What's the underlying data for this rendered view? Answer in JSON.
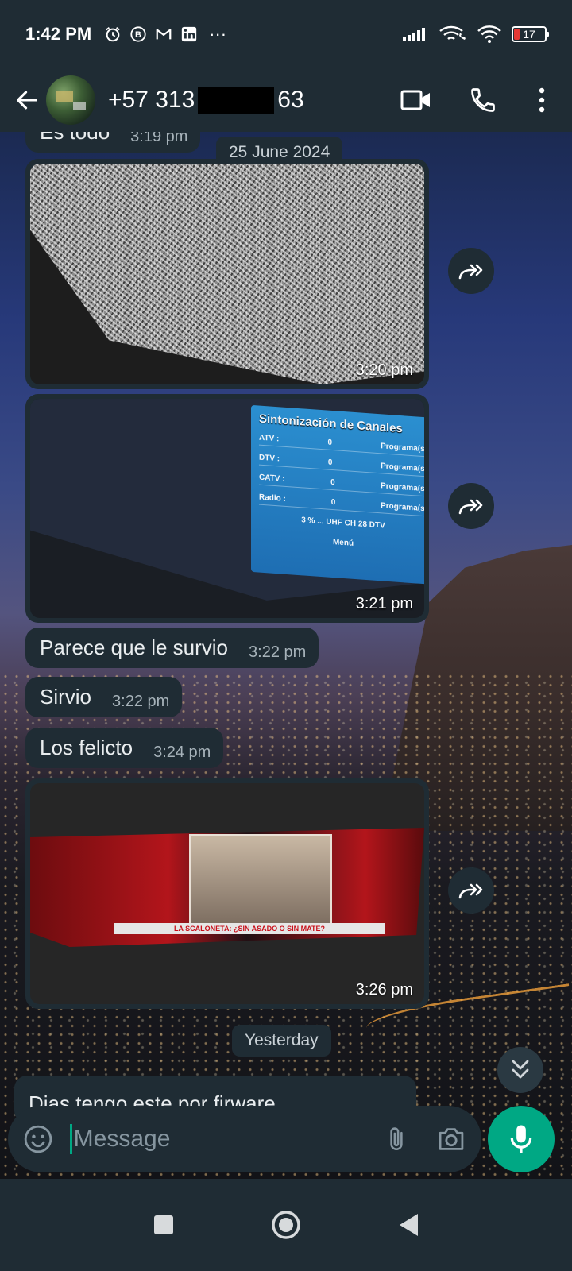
{
  "status_bar": {
    "time": "1:42 PM",
    "more": "···",
    "battery": "17",
    "icons": [
      "alarm-icon",
      "b-badge-icon",
      "gmail-icon",
      "linkedin-icon",
      "signal-icon",
      "wifi-call-icon",
      "wifi-icon",
      "battery-icon"
    ]
  },
  "header": {
    "phone_prefix": "+57 313",
    "phone_suffix": "63",
    "icons": [
      "back-arrow-icon",
      "video-call-icon",
      "phone-icon",
      "more-vert-icon"
    ]
  },
  "messages": [
    {
      "type": "text",
      "text": "Es todo",
      "time": "3:19 pm"
    },
    {
      "type": "date",
      "text": "25 June 2024"
    },
    {
      "type": "image",
      "description": "static",
      "time": "3:20 pm"
    },
    {
      "type": "image",
      "description": "tuning-menu",
      "time": "3:21 pm"
    },
    {
      "type": "text",
      "text": "Parece que le survio",
      "time": "3:22 pm"
    },
    {
      "type": "text",
      "text": "Sirvio",
      "time": "3:22 pm"
    },
    {
      "type": "text",
      "text": "Los felicto",
      "time": "3:24 pm"
    },
    {
      "type": "image",
      "description": "broadcast",
      "time": "3:26 pm"
    },
    {
      "type": "date",
      "text": "Yesterday"
    },
    {
      "type": "text",
      "text": "Dias tengo este por firware",
      "time": ""
    }
  ],
  "menu_panel": {
    "title": "Sintonización de Canales",
    "rows": [
      {
        "label": "ATV :",
        "value": "0",
        "unit": "Programa(s)"
      },
      {
        "label": "DTV :",
        "value": "0",
        "unit": "Programa(s)"
      },
      {
        "label": "CATV :",
        "value": "0",
        "unit": "Programa(s)"
      },
      {
        "label": "Radio :",
        "value": "0",
        "unit": "Programa(s)"
      }
    ],
    "footer": "3 % ... UHF CH 28 DTV",
    "menu": "Menú"
  },
  "tv_ticker": "LA SCALONETA: ¿SIN ASADO O SIN MATE?",
  "composer": {
    "placeholder": "Message",
    "icons": [
      "emoji-icon",
      "attach-icon",
      "camera-icon",
      "mic-icon"
    ]
  },
  "nav": {
    "icons": [
      "recents-square-icon",
      "home-circle-icon",
      "back-triangle-icon"
    ]
  },
  "colors": {
    "bar_bg": "#1f2c34",
    "bubble_bg": "#1f2c34",
    "accent": "#00a884",
    "time_text": "#a7b3ba"
  }
}
